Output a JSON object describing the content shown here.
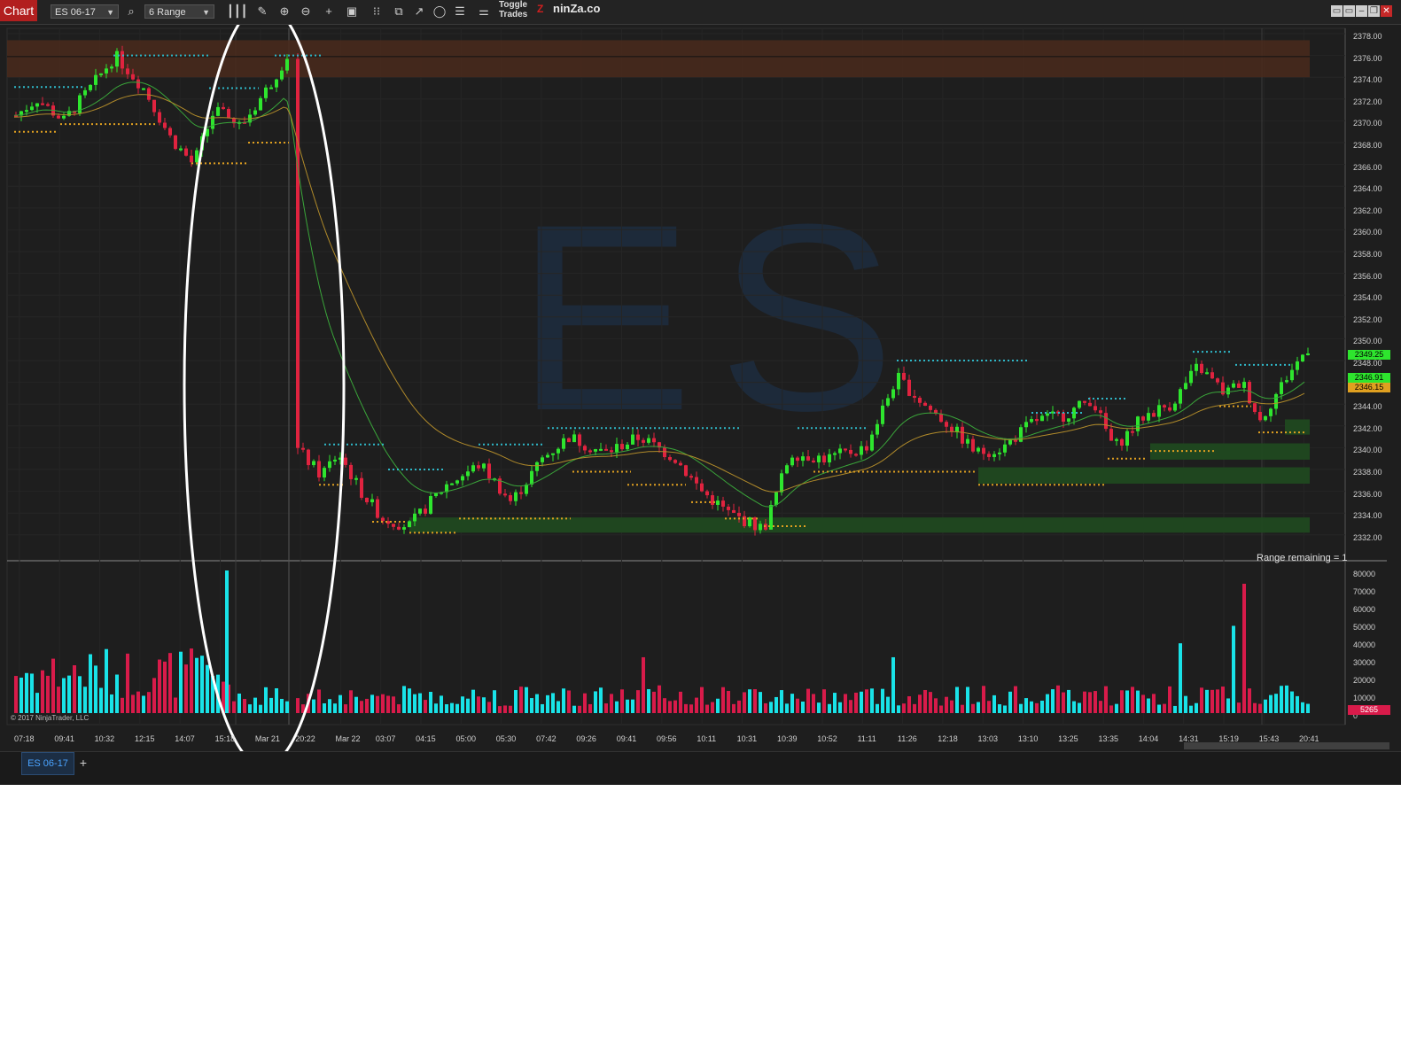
{
  "toolbar": {
    "chart_tab": "Chart",
    "instrument": "ES 06-17",
    "period": "6 Range",
    "toggle_line1": "Toggle",
    "toggle_line2": "Trades",
    "brand_mark": "Z",
    "brand": "ninZa.co"
  },
  "chart": {
    "watermark": "ES",
    "copyright": "© 2017 NinjaTrader, LLC",
    "range_remaining": "Range remaining = 1",
    "price_axis": [
      "2378.00",
      "2376.00",
      "2374.00",
      "2372.00",
      "2370.00",
      "2368.00",
      "2366.00",
      "2364.00",
      "2362.00",
      "2360.00",
      "2358.00",
      "2356.00",
      "2354.00",
      "2352.00",
      "2350.00",
      "2348.00",
      "2346.00",
      "2344.00",
      "2342.00",
      "2340.00",
      "2338.00",
      "2336.00",
      "2334.00",
      "2332.00"
    ],
    "volume_axis": [
      "80000",
      "70000",
      "60000",
      "50000",
      "40000",
      "30000",
      "20000",
      "10000",
      "0"
    ],
    "time_axis": [
      "07:18",
      "09:41",
      "10:32",
      "12:15",
      "14:07",
      "15:18",
      "Mar 21",
      "20:22",
      "Mar 22",
      "03:07",
      "04:15",
      "05:00",
      "05:30",
      "07:42",
      "09:26",
      "09:41",
      "09:56",
      "10:11",
      "10:31",
      "10:39",
      "10:52",
      "11:11",
      "11:26",
      "12:18",
      "13:03",
      "13:10",
      "13:25",
      "13:35",
      "14:04",
      "14:31",
      "15:19",
      "15:43",
      "20:41"
    ],
    "price_tags": {
      "last": "2349.25",
      "ema_fast": "2346.91",
      "ema_slow": "2346.15",
      "volume": "5265"
    },
    "colors": {
      "up_candle": "#2ee52e",
      "down_candle": "#e0233f",
      "up_volume": "#19e3e8",
      "down_volume": "#d81b4a",
      "resistance_zone": "#4a2a1c",
      "support_zone": "#1f4a1f",
      "highlight_ellipse": "#ffffff"
    }
  },
  "tabs": {
    "active": "ES 06-17",
    "add": "+"
  }
}
